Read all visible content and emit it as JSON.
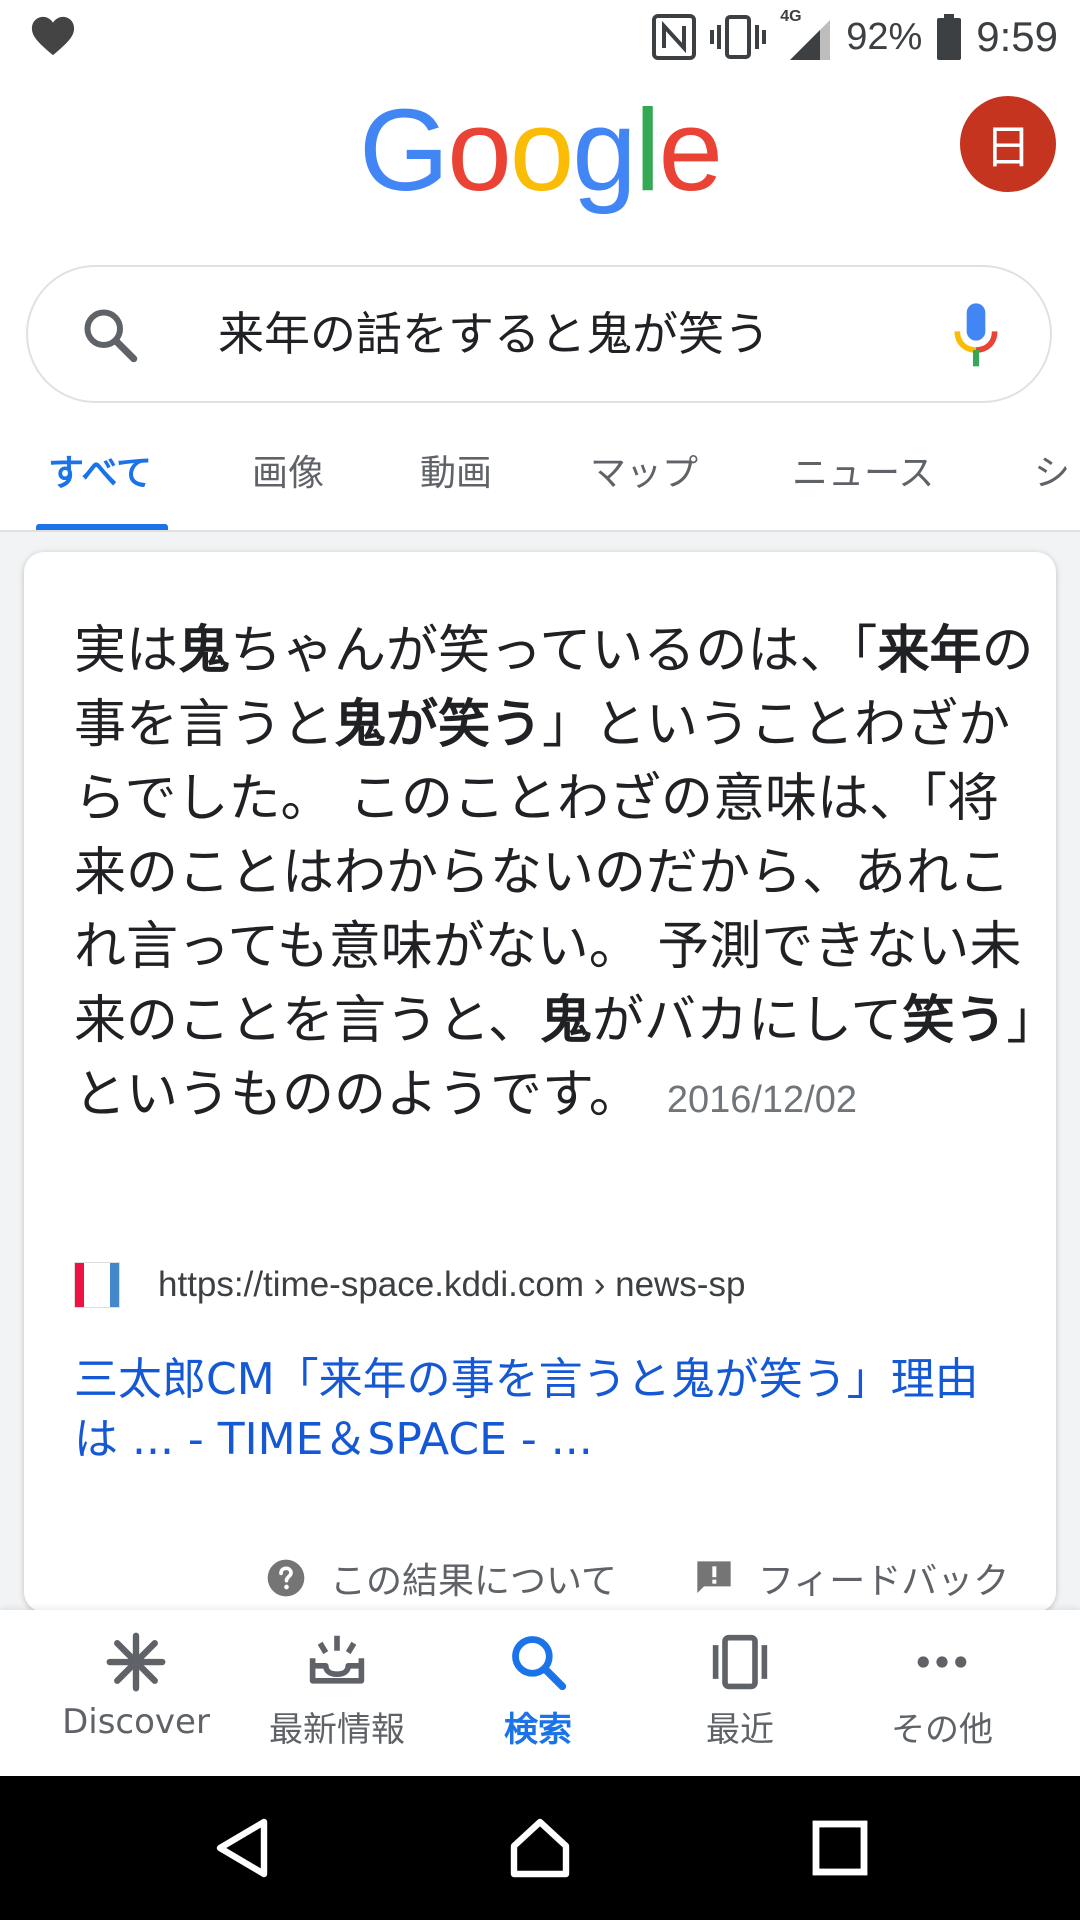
{
  "status_bar": {
    "network": "4G",
    "battery": "92%",
    "time": "9:59"
  },
  "header": {
    "logo_letters": [
      {
        "char": "G",
        "color": "#4285F4"
      },
      {
        "char": "o",
        "color": "#EA4335"
      },
      {
        "char": "o",
        "color": "#FBBC05"
      },
      {
        "char": "g",
        "color": "#4285F4"
      },
      {
        "char": "l",
        "color": "#34A853"
      },
      {
        "char": "e",
        "color": "#EA4335"
      }
    ],
    "avatar_initial": "日",
    "avatar_color": "#C5341F"
  },
  "search": {
    "query": "来年の話をすると鬼が笑う"
  },
  "tabs": [
    {
      "label": "すべて",
      "active": true
    },
    {
      "label": "画像"
    },
    {
      "label": "動画"
    },
    {
      "label": "マップ"
    },
    {
      "label": "ニュース"
    },
    {
      "label": "シ"
    }
  ],
  "featured_snippet": {
    "segments": [
      {
        "text": "実は",
        "bold": false
      },
      {
        "text": "鬼",
        "bold": true
      },
      {
        "text": "ちゃんが笑っているのは、「",
        "bold": false
      },
      {
        "text": "来年",
        "bold": true
      },
      {
        "text": "の事を言うと",
        "bold": false
      },
      {
        "text": "鬼が笑う",
        "bold": true
      },
      {
        "text": "」ということわざからでした。 このことわざの意味は、「将来のことはわからないのだから、あれこれ言っても意味がない。 予測できない未来のことを言うと、",
        "bold": false
      },
      {
        "text": "鬼",
        "bold": true
      },
      {
        "text": "がバカにして",
        "bold": false
      },
      {
        "text": "笑う",
        "bold": true
      },
      {
        "text": "」というもののようです。",
        "bold": false
      }
    ],
    "date": "2016/12/02",
    "source_url": "https://time-space.kddi.com › news-sp",
    "title": "三太郎CM「来年の事を言うと鬼が笑う」理由は ... - TIME＆SPACE - ...",
    "about_label": "この結果について",
    "feedback_label": "フィードバック"
  },
  "bottom_nav": [
    {
      "label": "Discover",
      "icon": "discover-asterisk-icon"
    },
    {
      "label": "最新情報",
      "icon": "updates-tray-icon"
    },
    {
      "label": "検索",
      "icon": "search-icon",
      "active": true
    },
    {
      "label": "最近",
      "icon": "recent-cards-icon"
    },
    {
      "label": "その他",
      "icon": "more-dots-icon"
    }
  ],
  "colors": {
    "accent": "#1A73E8",
    "link": "#1558D6"
  }
}
